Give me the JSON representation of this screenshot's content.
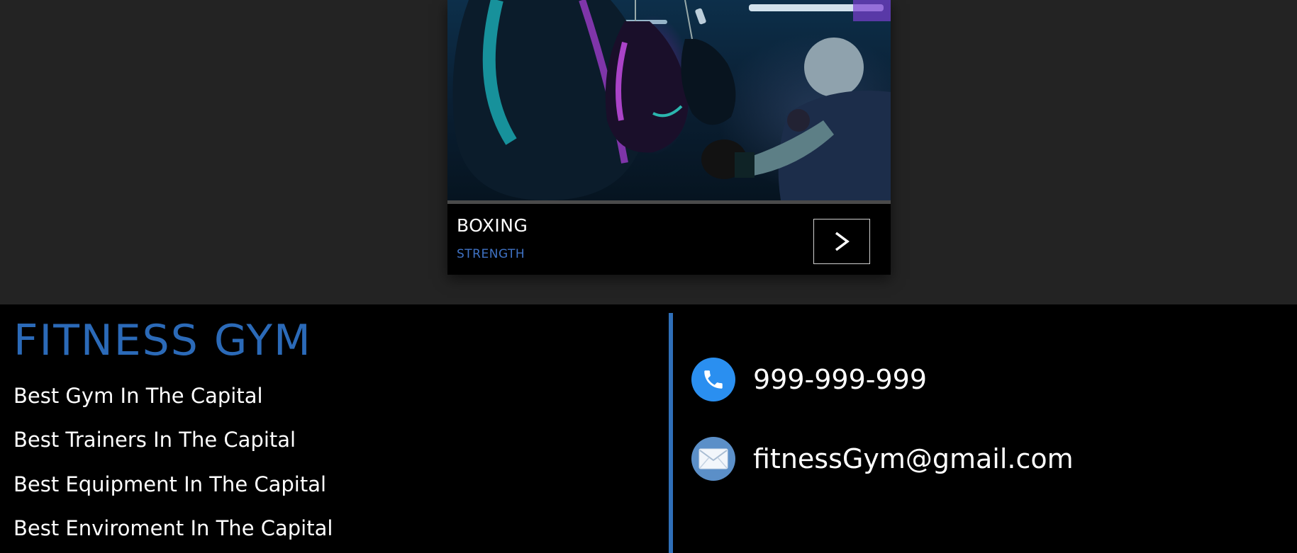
{
  "card": {
    "title": "BOXING",
    "subtitle": "STRENGTH",
    "next_label": ">",
    "image_alt": "boxing training photo",
    "progress_fraction": 0
  },
  "footer": {
    "brand": "FITNESS GYM",
    "taglines": [
      "Best Gym In The Capital",
      "Best Trainers In The Capital",
      "Best Equipment In The Capital",
      "Best Enviroment In The Capital"
    ],
    "phone": "999-999-999",
    "email": "fitnessGym@gmail.com",
    "phone_icon": "phone-icon",
    "email_icon": "envelope-icon"
  },
  "colors": {
    "background": "#232323",
    "footer_bg": "#000000",
    "brand_blue": "#2b6ab8",
    "subtitle_blue": "#3f72c4",
    "phone_icon_bg": "#2a8ff0",
    "email_icon_bg": "#5b8fc8"
  }
}
